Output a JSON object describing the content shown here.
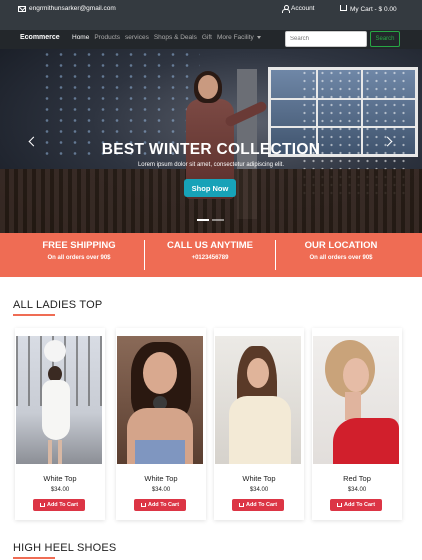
{
  "topbar": {
    "email": "engrmithunsarker@gmail.com",
    "account": "Account",
    "cart": "My Cart - $ 0.00"
  },
  "navbar": {
    "brand": "Ecommerce",
    "links": [
      "Home",
      "Products",
      "services",
      "Shops & Deals",
      "Gift",
      "More Facility"
    ],
    "search_placeholder": "Search",
    "search_button": "Search"
  },
  "hero": {
    "title": "BEST WINTER COLLECTION",
    "subtitle": "Lorem ipsum dolor sit amet, consectetur adipiscing elit.",
    "button": "Shop Now",
    "slide_count": 2,
    "active_slide": 1
  },
  "info": [
    {
      "title": "FREE SHIPPING",
      "sub": "On all orders over 90$"
    },
    {
      "title": "CALL US ANYTIME",
      "sub": "+0123456789"
    },
    {
      "title": "OUR LOCATION",
      "sub": "On all orders over 90$"
    }
  ],
  "sections": {
    "ladies_top": "ALL LADIES TOP",
    "heel_shoes": "HIGH HEEL SHOES"
  },
  "products": [
    {
      "name": "White Top",
      "price": "$34.00",
      "button": "Add To Cart"
    },
    {
      "name": "White Top",
      "price": "$34.00",
      "button": "Add To Cart"
    },
    {
      "name": "White Top",
      "price": "$34.00",
      "button": "Add To Cart"
    },
    {
      "name": "Red Top",
      "price": "$34.00",
      "button": "Add To Cart"
    }
  ],
  "colors": {
    "accent": "#ef6c54",
    "cart_button": "#dc3545",
    "shop_button": "#17a2b8",
    "search_button": "#28a745",
    "topbar": "#343a40",
    "navbar": "#23272b"
  }
}
